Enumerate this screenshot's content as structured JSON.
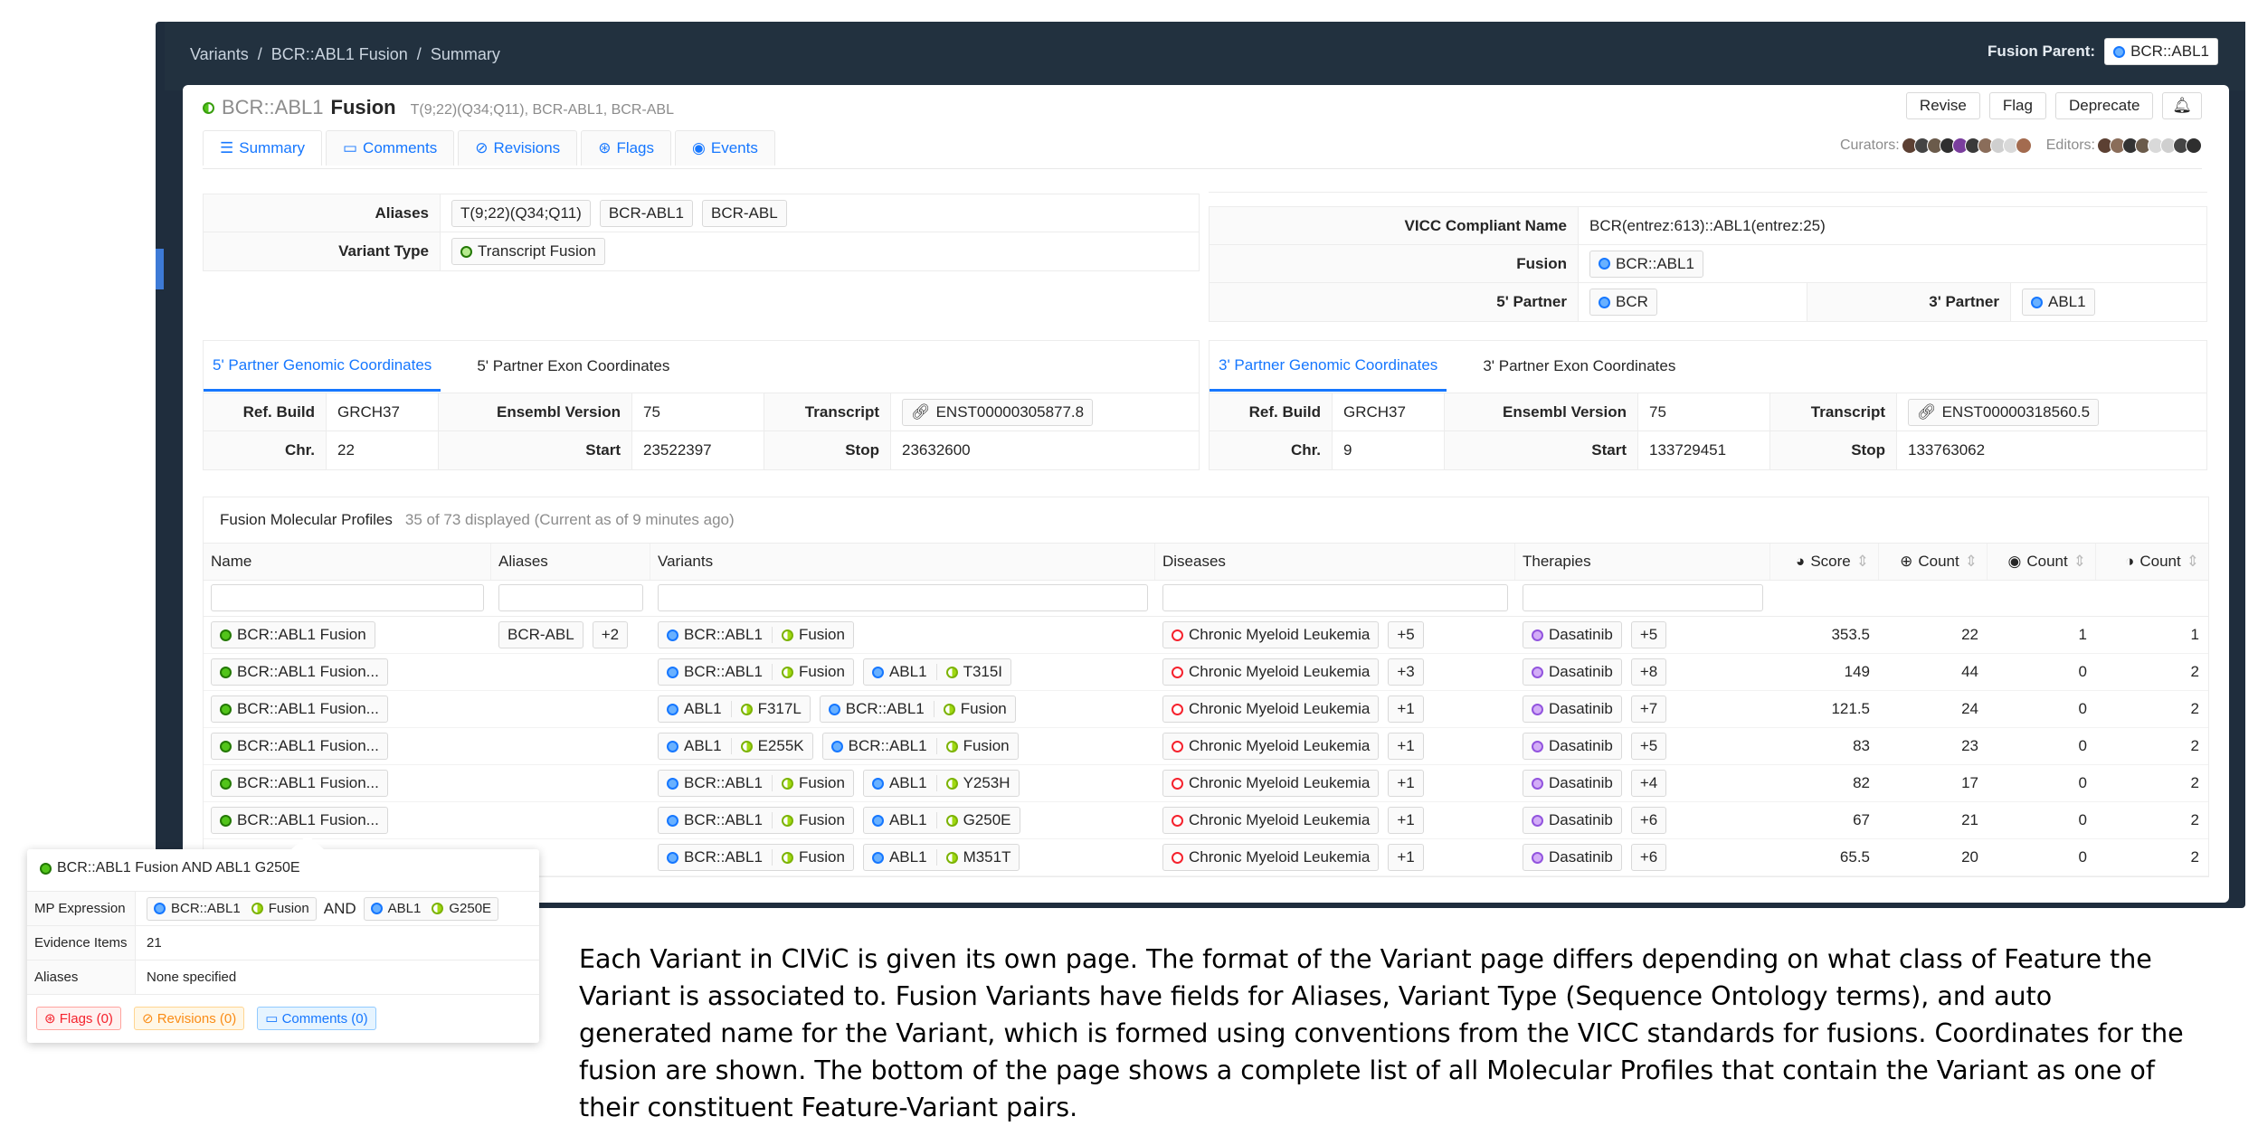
{
  "breadcrumb": [
    "Variants",
    "BCR::ABL1 Fusion",
    "Summary"
  ],
  "fusion_parent": {
    "label": "Fusion Parent:",
    "value": "BCR::ABL1"
  },
  "header": {
    "feature": "BCR::ABL1",
    "variant": "Fusion",
    "aliases_inline": "T(9;22)(Q34;Q11),  BCR-ABL1,  BCR-ABL",
    "actions": [
      "Revise",
      "Flag",
      "Deprecate"
    ],
    "tabs": [
      "Summary",
      "Comments",
      "Revisions",
      "Flags",
      "Events"
    ],
    "curators_label": "Curators:",
    "editors_label": "Editors:"
  },
  "summary": {
    "aliases_label": "Aliases",
    "aliases": [
      "T(9;22)(Q34;Q11)",
      "BCR-ABL1",
      "BCR-ABL"
    ],
    "variant_type_label": "Variant Type",
    "variant_type": "Transcript Fusion",
    "vicc_label": "VICC Compliant Name",
    "vicc_name": "BCR(entrez:613)::ABL1(entrez:25)",
    "fusion_label": "Fusion",
    "fusion": "BCR::ABL1",
    "five_partner_label": "5' Partner",
    "five_partner": "BCR",
    "three_partner_label": "3' Partner",
    "three_partner": "ABL1"
  },
  "coords": {
    "left": {
      "tabs": [
        "5' Partner Genomic Coordinates",
        "5' Partner Exon Coordinates"
      ],
      "ref_build_label": "Ref. Build",
      "ref_build": "GRCH37",
      "ensembl_label": "Ensembl Version",
      "ensembl": "75",
      "transcript_label": "Transcript",
      "transcript": "ENST00000305877.8",
      "chr_label": "Chr.",
      "chr": "22",
      "start_label": "Start",
      "start": "23522397",
      "stop_label": "Stop",
      "stop": "23632600"
    },
    "right": {
      "tabs": [
        "3' Partner Genomic Coordinates",
        "3' Partner Exon Coordinates"
      ],
      "ref_build_label": "Ref. Build",
      "ref_build": "GRCH37",
      "ensembl_label": "Ensembl Version",
      "ensembl": "75",
      "transcript_label": "Transcript",
      "transcript": "ENST00000318560.5",
      "chr_label": "Chr.",
      "chr": "9",
      "start_label": "Start",
      "start": "133729451",
      "stop_label": "Stop",
      "stop": "133763062"
    }
  },
  "mp": {
    "title": "Fusion Molecular Profiles",
    "subtitle": "35 of 73 displayed (Current as of 9 minutes ago)",
    "columns": [
      "Name",
      "Aliases",
      "Variants",
      "Diseases",
      "Therapies",
      "Score",
      "Count",
      "Count",
      "Count"
    ],
    "rows": [
      {
        "name": "BCR::ABL1 Fusion",
        "aliases": [
          "BCR-ABL",
          "+2"
        ],
        "variants": [
          [
            "BCR::ABL1",
            "Fusion"
          ]
        ],
        "disease": "Chronic Myeloid Leukemia",
        "disease_more": "+5",
        "therapy": "Dasatinib",
        "therapy_more": "+5",
        "score": "353.5",
        "c1": "22",
        "c2": "1",
        "c3": "1"
      },
      {
        "name": "BCR::ABL1 Fusion...",
        "aliases": [],
        "variants": [
          [
            "BCR::ABL1",
            "Fusion"
          ],
          [
            "ABL1",
            "T315I"
          ]
        ],
        "disease": "Chronic Myeloid Leukemia",
        "disease_more": "+3",
        "therapy": "Dasatinib",
        "therapy_more": "+8",
        "score": "149",
        "c1": "44",
        "c2": "0",
        "c3": "2"
      },
      {
        "name": "BCR::ABL1 Fusion...",
        "aliases": [],
        "variants": [
          [
            "ABL1",
            "F317L"
          ],
          [
            "BCR::ABL1",
            "Fusion"
          ]
        ],
        "disease": "Chronic Myeloid Leukemia",
        "disease_more": "+1",
        "therapy": "Dasatinib",
        "therapy_more": "+7",
        "score": "121.5",
        "c1": "24",
        "c2": "0",
        "c3": "2"
      },
      {
        "name": "BCR::ABL1 Fusion...",
        "aliases": [],
        "variants": [
          [
            "ABL1",
            "E255K"
          ],
          [
            "BCR::ABL1",
            "Fusion"
          ]
        ],
        "disease": "Chronic Myeloid Leukemia",
        "disease_more": "+1",
        "therapy": "Dasatinib",
        "therapy_more": "+5",
        "score": "83",
        "c1": "23",
        "c2": "0",
        "c3": "2"
      },
      {
        "name": "BCR::ABL1 Fusion...",
        "aliases": [],
        "variants": [
          [
            "BCR::ABL1",
            "Fusion"
          ],
          [
            "ABL1",
            "Y253H"
          ]
        ],
        "disease": "Chronic Myeloid Leukemia",
        "disease_more": "+1",
        "therapy": "Dasatinib",
        "therapy_more": "+4",
        "score": "82",
        "c1": "17",
        "c2": "0",
        "c3": "2"
      },
      {
        "name": "BCR::ABL1 Fusion...",
        "aliases": [],
        "variants": [
          [
            "BCR::ABL1",
            "Fusion"
          ],
          [
            "ABL1",
            "G250E"
          ]
        ],
        "disease": "Chronic Myeloid Leukemia",
        "disease_more": "+1",
        "therapy": "Dasatinib",
        "therapy_more": "+6",
        "score": "67",
        "c1": "21",
        "c2": "0",
        "c3": "2"
      },
      {
        "name": "",
        "aliases": [],
        "variants": [
          [
            "BCR::ABL1",
            "Fusion"
          ],
          [
            "ABL1",
            "M351T"
          ]
        ],
        "disease": "Chronic Myeloid Leukemia",
        "disease_more": "+1",
        "therapy": "Dasatinib",
        "therapy_more": "+6",
        "score": "65.5",
        "c1": "20",
        "c2": "0",
        "c3": "2"
      }
    ]
  },
  "popover": {
    "title": "BCR::ABL1 Fusion AND ABL1 G250E",
    "expr_label": "MP Expression",
    "expr_a_gene": "BCR::ABL1",
    "expr_a_var": "Fusion",
    "and": "AND",
    "expr_b_gene": "ABL1",
    "expr_b_var": "G250E",
    "evidence_label": "Evidence Items",
    "evidence": "21",
    "aliases_label": "Aliases",
    "aliases": "None specified",
    "flags": "Flags (0)",
    "revisions": "Revisions (0)",
    "comments": "Comments (0)"
  },
  "caption": "Each Variant in CIViC is given its own page. The format of the Variant page differs depending on what class of Feature the Variant is associated to. Fusion Variants have fields for Aliases, Variant Type (Sequence Ontology terms), and auto generated name for the Variant, which is formed using conventions from the VICC standards for fusions. Coordinates for the fusion are shown. The bottom of the page shows a complete list of all Molecular Profiles that contain the Variant as one of their constituent Feature-Variant pairs."
}
